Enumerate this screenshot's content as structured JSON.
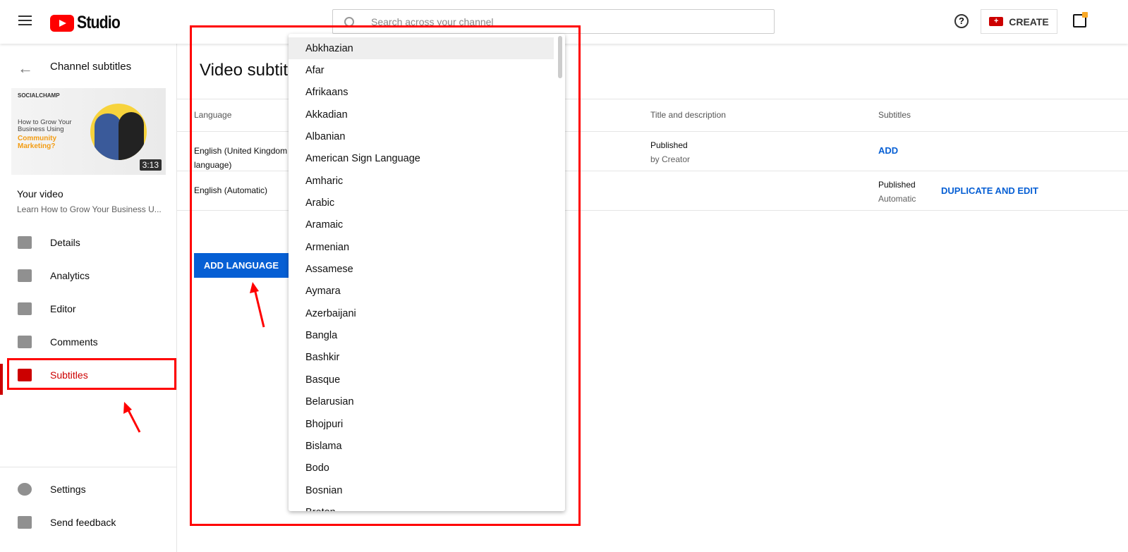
{
  "header": {
    "app": "Studio",
    "search_placeholder": "Search across your channel",
    "help": "?",
    "create_label": "CREATE"
  },
  "sidebar": {
    "back_title": "Channel subtitles",
    "thumbnail": {
      "brand": "SOCIALCHAMP",
      "line1": "How to Grow Your Business Using",
      "line2": "Community Marketing?",
      "duration": "3:13"
    },
    "your_video": "Your video",
    "video_title": "Learn How to Grow Your Business U...",
    "items": [
      {
        "label": "Details",
        "icon": "pencil-icon"
      },
      {
        "label": "Analytics",
        "icon": "analytics-icon"
      },
      {
        "label": "Editor",
        "icon": "clapperboard-icon"
      },
      {
        "label": "Comments",
        "icon": "comment-icon"
      },
      {
        "label": "Subtitles",
        "icon": "subtitles-icon",
        "active": true
      }
    ],
    "bottom": [
      {
        "label": "Settings",
        "icon": "gear-icon"
      },
      {
        "label": "Send feedback",
        "icon": "feedback-icon"
      }
    ]
  },
  "main": {
    "title": "Video subtitles",
    "columns": [
      "Language",
      "Title and description",
      "Subtitles"
    ],
    "rows": [
      {
        "language": "English (United Kingdom) (Video language)",
        "language_l1": "English (United Kingdom",
        "language_l2": "language)",
        "title_status": "Published",
        "title_sub": "by Creator",
        "subtitles_action": "ADD"
      },
      {
        "language": "English (Automatic)",
        "subtitles_status": "Published",
        "subtitles_sub": "Automatic",
        "subtitles_action": "DUPLICATE AND EDIT"
      }
    ],
    "add_language": "ADD LANGUAGE"
  },
  "dropdown": {
    "highlighted": "Abkhazian",
    "options": [
      "Abkhazian",
      "Afar",
      "Afrikaans",
      "Akkadian",
      "Albanian",
      "American Sign Language",
      "Amharic",
      "Arabic",
      "Aramaic",
      "Armenian",
      "Assamese",
      "Aymara",
      "Azerbaijani",
      "Bangla",
      "Bashkir",
      "Basque",
      "Belarusian",
      "Bhojpuri",
      "Bislama",
      "Bodo",
      "Bosnian",
      "Breton"
    ]
  },
  "colors": {
    "accent": "#065fd4",
    "active": "#cc0000",
    "annotation": "#ff0000"
  }
}
